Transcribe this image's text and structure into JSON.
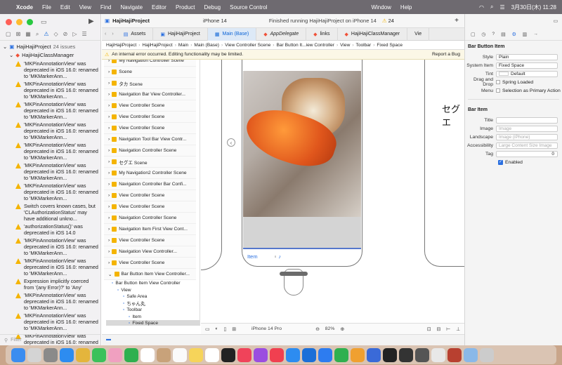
{
  "menubar": {
    "apple": "",
    "app": "Xcode",
    "items": [
      "File",
      "Edit",
      "View",
      "Find",
      "Navigate",
      "Editor",
      "Product",
      "Debug",
      "Source Control"
    ],
    "window": "Window",
    "help": "Help",
    "clock": "3月30日(木) 11:28"
  },
  "toolbar": {
    "project_title": "HajiHajiProject",
    "device": "iPhone 14",
    "status": "Finished running HajiHajiProject on iPhone 14",
    "warning_count": "24"
  },
  "tabs": [
    "Assets",
    "HajiHajiProject",
    "Main (Base)",
    "AppDelegate",
    "links",
    "HajiHajiClassManager",
    "Vie"
  ],
  "jumpbar": [
    "HajiHajiProject",
    "HajiHajiProject",
    "Main",
    "Main (Base)",
    "View Controller Scene",
    "Bar Button It...iew Controller",
    "View",
    "Toolbar",
    "Fixed Space"
  ],
  "warning_banner": {
    "text": "An internal error occurred. Editing functionality may be limited.",
    "action": "Report a Bug"
  },
  "navigator": {
    "project": "HajiHajiProject",
    "issue_count": "24 issues",
    "group": "HajiHajiClassManager",
    "issues": [
      "'MKPinAnnotationView' was deprecated in iOS 16.0: renamed to 'MKMarkerAnn...",
      "'MKPinAnnotationView' was deprecated in iOS 16.0: renamed to 'MKMarkerAnn...",
      "'MKPinAnnotationView' was deprecated in iOS 16.0: renamed to 'MKMarkerAnn...",
      "'MKPinAnnotationView' was deprecated in iOS 16.0: renamed to 'MKMarkerAnn...",
      "'MKPinAnnotationView' was deprecated in iOS 16.0: renamed to 'MKMarkerAnn...",
      "'MKPinAnnotationView' was deprecated in iOS 16.0: renamed to 'MKMarkerAnn...",
      "'MKPinAnnotationView' was deprecated in iOS 16.0: renamed to 'MKMarkerAnn...",
      "Switch covers known cases, but 'CLAuthorizationStatus' may have additional unkno...",
      "'authorizationStatus()' was deprecated in iOS 14.0",
      "'MKPinAnnotationView' was deprecated in iOS 16.0: renamed to 'MKMarkerAnn...",
      "'MKPinAnnotationView' was deprecated in iOS 16.0: renamed to 'MKMarkerAnn...",
      "Expression implicitly coerced from '(any Error)?' to 'Any'",
      "'MKPinAnnotationView' was deprecated in iOS 16.0: renamed to 'MKMarkerAnn...",
      "'MKPinAnnotationView' was deprecated in iOS 16.0: renamed to 'MKMarkerAnn...",
      "'MKPinAnnotationView' was deprecated in iOS 16.0: renamed to 'MKMarkerAnn..."
    ],
    "filter_placeholder": "Filter"
  },
  "outline": {
    "scenes": [
      "My Navigation Controller Scene",
      "Scene",
      "タカ Scene",
      "Navigation Bar View Controller...",
      "View Controller Scene",
      "View Controller Scene",
      "View Controller Scene",
      "Navigation Tool Bar View Contr...",
      "Navigation Controller Scene",
      "セグエ Scene",
      "My Navigation2 Controller Scene",
      "Navigation Controller Bar Confi...",
      "View Controller Scene",
      "View Controller Scene",
      "Navigation Controller Scene",
      "Navigation Item First View Cont...",
      "View Controller Scene",
      "Navigation View Controller...",
      "View Controller Scene",
      "Bar Button Item View Controller..."
    ],
    "tree": [
      {
        "label": "Bar Button Item View Controller",
        "indent": 1
      },
      {
        "label": "View",
        "indent": 2
      },
      {
        "label": "Safe Area",
        "indent": 3
      },
      {
        "label": "ちゃん丸",
        "indent": 3
      },
      {
        "label": "Toolbar",
        "indent": 3
      },
      {
        "label": "Item",
        "indent": 4
      },
      {
        "label": "Fixed Space",
        "indent": 4
      }
    ],
    "filter_placeholder": "Filter"
  },
  "canvas": {
    "toolbar_item": "Item",
    "right_label": "セグエ",
    "device_config": "iPhone 14 Pro",
    "zoom": "82%"
  },
  "inspector": {
    "section_bar_button": "Bar Button Item",
    "style_label": "Style",
    "style_value": "Plain",
    "system_item_label": "System Item",
    "system_item_value": "Fixed Space",
    "tint_label": "Tint",
    "tint_value": "Default",
    "drag_drop_label": "Drag and Drop",
    "drag_drop_value": "Spring Loaded",
    "menu_label": "Menu",
    "menu_value": "Selection as Primary Action",
    "section_bar_item": "Bar Item",
    "title_label": "Title",
    "image_label": "Image",
    "image_placeholder": "Image",
    "landscape_label": "Landscape",
    "landscape_placeholder": "Image (iPhone)",
    "accessibility_label": "Accessibility",
    "accessibility_placeholder": "Large Content Size Image",
    "tag_label": "Tag",
    "tag_value": "0",
    "enabled_label": "Enabled"
  }
}
